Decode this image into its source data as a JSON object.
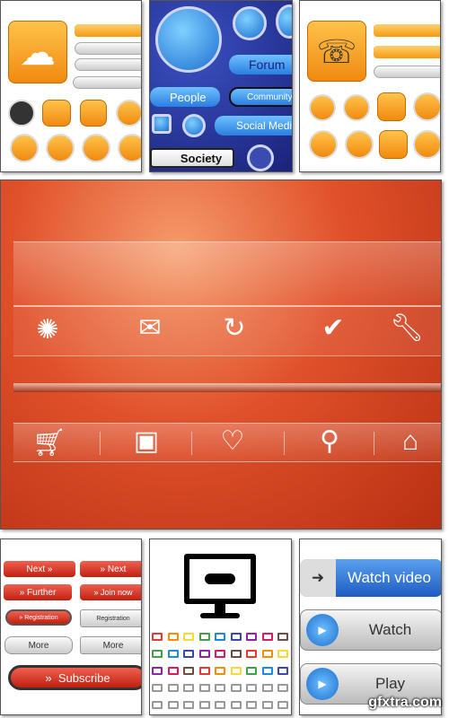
{
  "panel_social": {
    "buttons": [
      "Forum",
      "People",
      "Community",
      "Social Media",
      "Society"
    ]
  },
  "panel_buttons": {
    "labels": [
      "Next",
      "Next",
      "Further",
      "Join now",
      "Registration",
      "Registration",
      "More",
      "More",
      "Subscribe"
    ]
  },
  "panel_video": {
    "buttons": [
      "Watch video",
      "Watch",
      "Play"
    ]
  },
  "middle": {
    "top_icons": [
      "spinner-icon",
      "mail-icon",
      "refresh-icon",
      "check-circle-icon",
      "wrench-icon"
    ],
    "bottom_icons": [
      "cart-icon",
      "save-icon",
      "heart-plus-icon",
      "search-icon",
      "home-icon"
    ]
  },
  "colors": {
    "orange": "#f08a10",
    "blue": "#1a237a",
    "red": "#c02010",
    "background_mid": "#e0502a"
  },
  "watermark": "gfxtra.com"
}
